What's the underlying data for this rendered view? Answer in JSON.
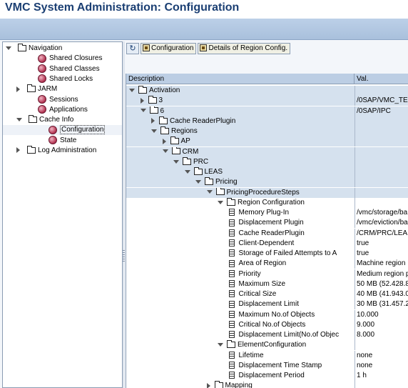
{
  "window": {
    "title": "VMC System Administration: Configuration"
  },
  "navigation": {
    "items": [
      {
        "label": "Navigation",
        "level": 0,
        "expander": "expanded",
        "icon": "folder-icon"
      },
      {
        "label": "Shared Closures",
        "level": 1,
        "expander": "none",
        "icon": "cube-icon"
      },
      {
        "label": "Shared Classes",
        "level": 1,
        "expander": "none",
        "icon": "cube-icon"
      },
      {
        "label": "Shared Locks",
        "level": 1,
        "expander": "none",
        "icon": "cube-icon"
      },
      {
        "label": "JARM",
        "level": 1,
        "expander": "collapsed",
        "icon": "folder-icon"
      },
      {
        "label": "Sessions",
        "level": 1,
        "expander": "none",
        "icon": "cube-icon"
      },
      {
        "label": "Applications",
        "level": 1,
        "expander": "none",
        "icon": "cube-icon"
      },
      {
        "label": "Cache Info",
        "level": 1,
        "expander": "expanded",
        "icon": "folder-icon"
      },
      {
        "label": "Configuration",
        "level": 2,
        "expander": "none",
        "icon": "cube-icon",
        "selected": true
      },
      {
        "label": "State",
        "level": 2,
        "expander": "none",
        "icon": "cube-icon"
      },
      {
        "label": "Log Administration",
        "level": 1,
        "expander": "collapsed",
        "icon": "folder-icon"
      }
    ]
  },
  "toolbar": {
    "refresh_icon": "refresh-icon",
    "configuration_label": "Configuration",
    "details_label": "Details of Region Config."
  },
  "grid": {
    "headers": {
      "description": "Description",
      "value": "Val."
    },
    "rows": [
      {
        "desc": "Activation",
        "val": "",
        "level": 0,
        "expander": "expanded",
        "icon": "folder"
      },
      {
        "desc": "3",
        "val": "/0SAP/VMC_TE",
        "level": 1,
        "expander": "collapsed",
        "icon": "folder"
      },
      {
        "desc": "6",
        "val": "/0SAP/IPC",
        "level": 1,
        "expander": "expanded",
        "icon": "folder"
      },
      {
        "desc": "Cache ReaderPlugin",
        "val": "",
        "level": 2,
        "expander": "collapsed",
        "icon": "folder"
      },
      {
        "desc": "Regions",
        "val": "",
        "level": 2,
        "expander": "expanded",
        "icon": "folder"
      },
      {
        "desc": "AP",
        "val": "",
        "level": 3,
        "expander": "collapsed",
        "icon": "folder"
      },
      {
        "desc": "CRM",
        "val": "",
        "level": 3,
        "expander": "expanded",
        "icon": "folder"
      },
      {
        "desc": "PRC",
        "val": "",
        "level": 4,
        "expander": "expanded",
        "icon": "folder"
      },
      {
        "desc": "LEAS",
        "val": "",
        "level": 5,
        "expander": "expanded",
        "icon": "folder"
      },
      {
        "desc": "Pricing",
        "val": "",
        "level": 6,
        "expander": "expanded",
        "icon": "folder"
      },
      {
        "desc": "PricingProcedureSteps",
        "val": "",
        "level": 7,
        "expander": "expanded",
        "icon": "folder"
      },
      {
        "desc": "Region Configuration",
        "val": "",
        "level": 8,
        "expander": "expanded",
        "icon": "folder"
      },
      {
        "desc": "Memory Plug-In",
        "val": "/vmc/storage/ba",
        "level": 9,
        "expander": "none",
        "icon": "doc"
      },
      {
        "desc": "Displacement Plugin",
        "val": "/vmc/eviction/ba",
        "level": 9,
        "expander": "none",
        "icon": "doc"
      },
      {
        "desc": "Cache ReaderPlugin",
        "val": "/CRM/PRC/LEA",
        "level": 9,
        "expander": "none",
        "icon": "doc"
      },
      {
        "desc": "Client-Dependent",
        "val": "true",
        "level": 9,
        "expander": "none",
        "icon": "doc"
      },
      {
        "desc": "Storage of Failed Attempts to A",
        "val": "true",
        "level": 9,
        "expander": "none",
        "icon": "doc"
      },
      {
        "desc": "Area of Region",
        "val": "Machine region",
        "level": 9,
        "expander": "none",
        "icon": "doc"
      },
      {
        "desc": "Priority",
        "val": "Medium region p",
        "level": 9,
        "expander": "none",
        "icon": "doc"
      },
      {
        "desc": "Maximum Size",
        "val": "50 MB (52.428.8",
        "level": 9,
        "expander": "none",
        "icon": "doc"
      },
      {
        "desc": "Critical Size",
        "val": "40 MB (41.943.0",
        "level": 9,
        "expander": "none",
        "icon": "doc"
      },
      {
        "desc": "Displacement Limit",
        "val": "30 MB (31.457.2",
        "level": 9,
        "expander": "none",
        "icon": "doc"
      },
      {
        "desc": "Maximum No.of Objects",
        "val": "10.000",
        "level": 9,
        "expander": "none",
        "icon": "doc"
      },
      {
        "desc": "Critical No.of Objects",
        "val": "9.000",
        "level": 9,
        "expander": "none",
        "icon": "doc"
      },
      {
        "desc": "Displacement Limit(No.of Objec",
        "val": "8.000",
        "level": 9,
        "expander": "none",
        "icon": "doc"
      },
      {
        "desc": "ElementConfiguration",
        "val": "",
        "level": 8,
        "expander": "expanded",
        "icon": "folder"
      },
      {
        "desc": "Lifetime",
        "val": "none",
        "level": 9,
        "expander": "none",
        "icon": "doc"
      },
      {
        "desc": "Displacement Time Stamp",
        "val": "none",
        "level": 9,
        "expander": "none",
        "icon": "doc"
      },
      {
        "desc": "Displacement Period",
        "val": "1 h",
        "level": 9,
        "expander": "none",
        "icon": "doc"
      },
      {
        "desc": "Mapping",
        "val": "",
        "level": 7,
        "expander": "collapsed",
        "icon": "folder"
      }
    ]
  }
}
